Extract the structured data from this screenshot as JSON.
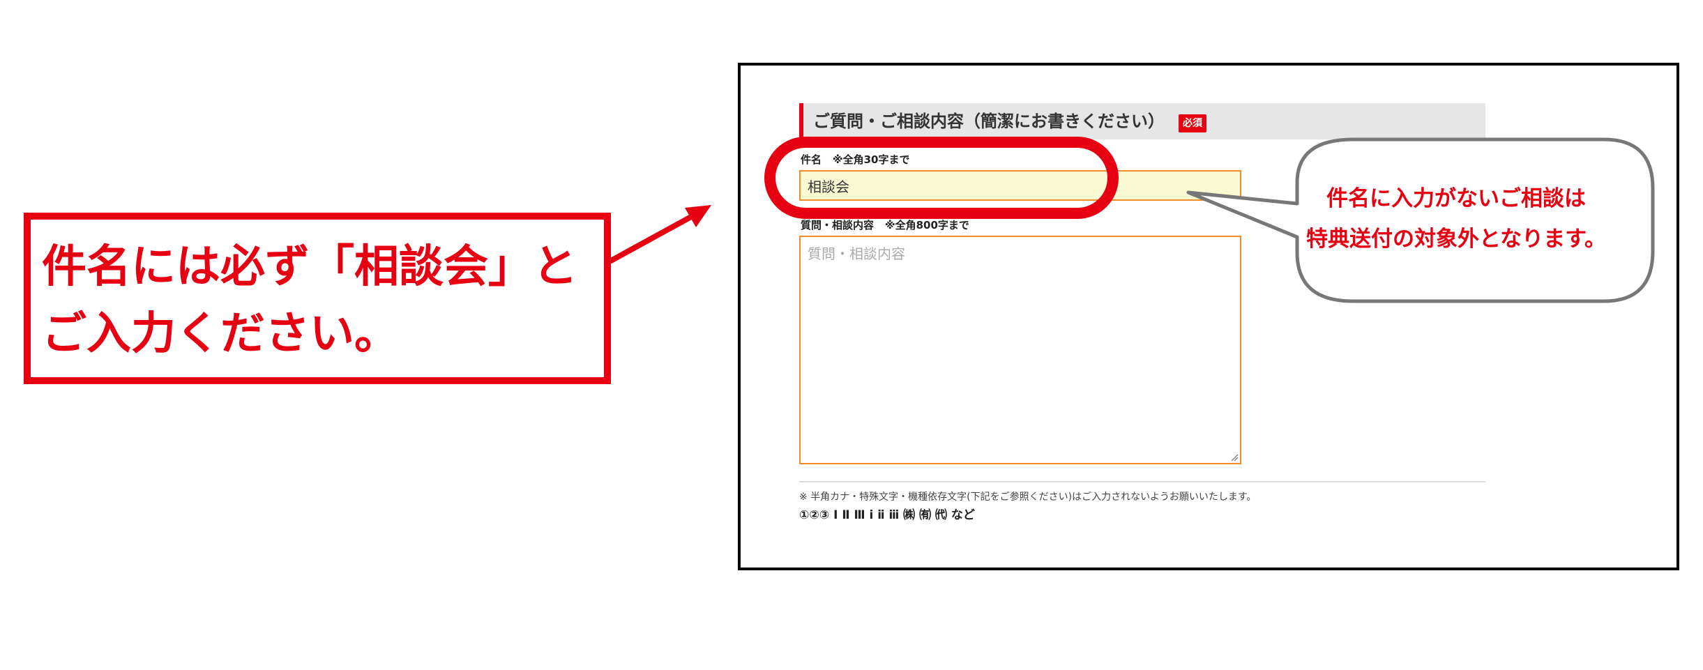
{
  "instruction": {
    "line1": "件名には必ず「相談会」と",
    "line2": "ご入力ください。"
  },
  "form": {
    "section_title": "ご質問・ご相談内容（簡潔にお書きください）",
    "required_badge": "必須",
    "subject": {
      "label": "件名",
      "note": "※全角30字まで",
      "value": "相談会"
    },
    "body": {
      "label": "質問・相談内容",
      "note": "※全角800字まで",
      "placeholder": "質問・相談内容"
    },
    "footnote": "※ 半角カナ・特殊文字・機種依存文字(下記をご参照ください)はご入力されないようお願いいたします。",
    "example_chars": "①②③ Ⅰ Ⅱ Ⅲ ⅰ ⅱ ⅲ ㈱ ㈲ ㈹ など"
  },
  "bubble": {
    "line1": "件名に入力がないご相談は",
    "line2": "特典送付の対象外となります。"
  },
  "colors": {
    "accent_red": "#e60012",
    "input_border": "#f28c28",
    "input_fill": "#fafad2",
    "bubble_border": "#777777"
  }
}
